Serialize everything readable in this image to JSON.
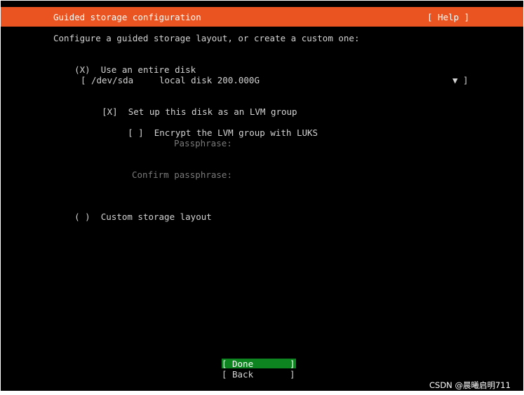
{
  "header": {
    "title": "Guided storage configuration",
    "help": "[ Help ]"
  },
  "colors": {
    "header_bg": "#e95420",
    "focus_bg": "#0e8420",
    "background": "#000000"
  },
  "intro": "Configure a guided storage layout, or create a custom one:",
  "entire_disk": {
    "radio": "(X)",
    "label": "Use an entire disk"
  },
  "disk_select": {
    "open": "[",
    "device": "/dev/sda",
    "description": "local disk 200.000G",
    "arrow": "▼",
    "close": "]"
  },
  "lvm": {
    "checkbox": "[X]",
    "label": "Set up this disk as an LVM group"
  },
  "luks": {
    "checkbox": "[ ]",
    "label": "Encrypt the LVM group with LUKS"
  },
  "passphrase_label": "Passphrase:",
  "confirm_label": "Confirm passphrase:",
  "custom": {
    "radio": "( )",
    "label": "Custom storage layout"
  },
  "buttons": {
    "done": "Done",
    "back": "Back"
  },
  "watermark": "CSDN @晨曦启明711"
}
